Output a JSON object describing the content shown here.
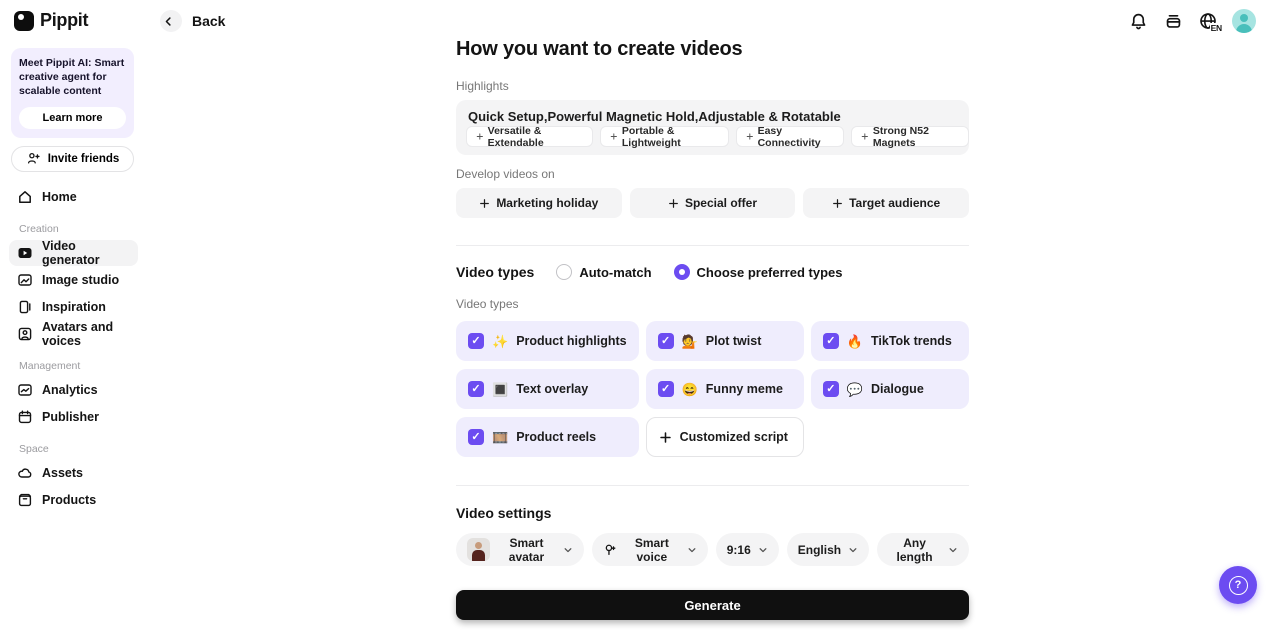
{
  "brand": {
    "name": "Pippit"
  },
  "header": {
    "back_label": "Back",
    "language": "EN",
    "icons": {
      "notifications": "bell-icon",
      "orders": "wallet-icon",
      "language": "globe-icon",
      "profile": "avatar"
    }
  },
  "sidebar": {
    "promo": {
      "title": "Meet Pippit AI: Smart creative agent for scalable content",
      "cta": "Learn more"
    },
    "invite_label": "Invite friends",
    "home_label": "Home",
    "sections": [
      {
        "label": "Creation",
        "items": [
          {
            "label": "Video generator",
            "icon": "video-generator-icon",
            "active": true
          },
          {
            "label": "Image studio",
            "icon": "image-studio-icon",
            "active": false
          },
          {
            "label": "Inspiration",
            "icon": "inspiration-icon",
            "active": false
          },
          {
            "label": "Avatars and voices",
            "icon": "avatars-icon",
            "active": false
          }
        ]
      },
      {
        "label": "Management",
        "items": [
          {
            "label": "Analytics",
            "icon": "analytics-icon",
            "active": false
          },
          {
            "label": "Publisher",
            "icon": "publisher-icon",
            "active": false
          }
        ]
      },
      {
        "label": "Space",
        "items": [
          {
            "label": "Assets",
            "icon": "cloud-icon",
            "active": false
          },
          {
            "label": "Products",
            "icon": "box-icon",
            "active": false
          }
        ]
      }
    ]
  },
  "main": {
    "title": "How you want to create videos",
    "highlights": {
      "label": "Highlights",
      "value": "Quick Setup,Powerful Magnetic Hold,Adjustable & Rotatable",
      "tags": [
        "Versatile & Extendable",
        "Portable & Lightweight",
        "Easy Connectivity",
        "Strong N52 Magnets"
      ]
    },
    "develop": {
      "label": "Develop videos on",
      "options": [
        "Marketing holiday",
        "Special offer",
        "Target audience"
      ]
    },
    "video_types": {
      "label": "Video types",
      "modes": [
        {
          "label": "Auto-match",
          "selected": false
        },
        {
          "label": "Choose preferred types",
          "selected": true
        }
      ],
      "sublabel": "Video types",
      "options": [
        {
          "label": "Product highlights",
          "emoji": "✨",
          "checked": true
        },
        {
          "label": "Plot twist",
          "emoji": "💁",
          "checked": true
        },
        {
          "label": "TikTok trends",
          "emoji": "🔥",
          "checked": true
        },
        {
          "label": "Text overlay",
          "emoji": "🔳",
          "checked": true
        },
        {
          "label": "Funny meme",
          "emoji": "😄",
          "checked": true
        },
        {
          "label": "Dialogue",
          "emoji": "💬",
          "checked": true
        },
        {
          "label": "Product reels",
          "emoji": "🎞️",
          "checked": true
        }
      ],
      "add_custom": "Customized script"
    },
    "settings": {
      "label": "Video settings",
      "avatar": "Smart avatar",
      "voice": "Smart voice",
      "ratio": "9:16",
      "language": "English",
      "length": "Any length"
    },
    "generate_label": "Generate"
  },
  "colors": {
    "accent": "#6C4CF1",
    "type_card_bg": "#EFEDFD",
    "input_bg": "#F4F4F5",
    "generate_bg": "#101010",
    "avatar_bg": "#A6E4E1"
  }
}
